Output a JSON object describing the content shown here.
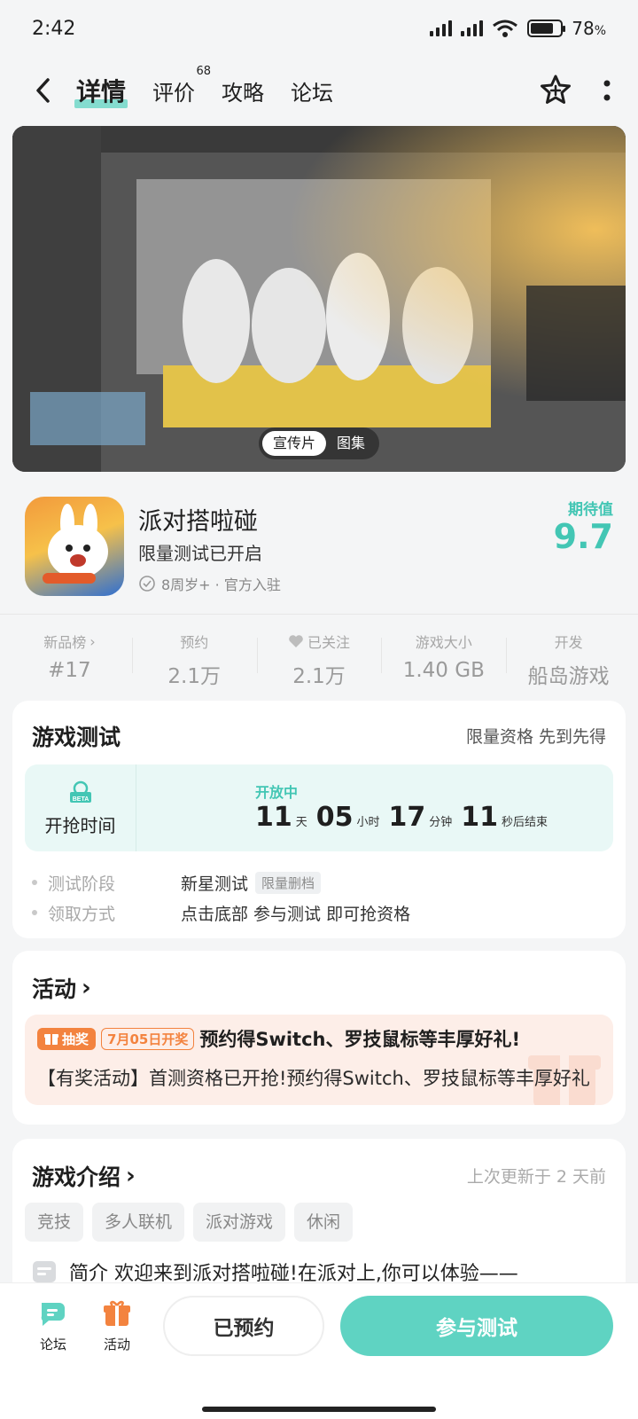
{
  "status": {
    "time": "2:42",
    "battery": "78",
    "battery_unit": "%"
  },
  "nav": {
    "tabs": [
      {
        "label": "详情"
      },
      {
        "label": "评价",
        "count": "68"
      },
      {
        "label": "攻略"
      },
      {
        "label": "论坛"
      }
    ]
  },
  "hero": {
    "toggle": [
      "宣传片",
      "图集"
    ]
  },
  "game": {
    "name": "派对搭啦碰",
    "subtitle": "限量测试已开启",
    "meta": "8周岁+ · 官方入驻",
    "expect_label": "期待值",
    "expect_value": "9.7"
  },
  "stats": [
    {
      "key": "新品榜",
      "value": "#17"
    },
    {
      "key": "预约",
      "value": "2.1万"
    },
    {
      "key": "已关注",
      "value": "2.1万"
    },
    {
      "key": "游戏大小",
      "value": "1.40 GB"
    },
    {
      "key": "开发",
      "value": "船岛游戏"
    }
  ],
  "test": {
    "title": "游戏测试",
    "note": "限量资格 先到先得",
    "box_label": "开抢时间",
    "status": "开放中",
    "countdown": {
      "d": "11",
      "d_unit": "天",
      "h": "05",
      "h_unit": "小时",
      "m": "17",
      "m_unit": "分钟",
      "s": "11",
      "s_unit": "秒后结束"
    },
    "rows": [
      {
        "key": "测试阶段",
        "value": "新星测试",
        "tag": "限量删档"
      },
      {
        "key": "领取方式",
        "value": "点击底部 参与测试 即可抢资格"
      }
    ]
  },
  "activity": {
    "title": "活动",
    "badge": "抽奖",
    "date_badge": "7月05日开奖",
    "headline": "预约得Switch、罗技鼠标等丰厚好礼!",
    "desc": "【有奖活动】首测资格已开抢!预约得Switch、罗技鼠标等丰厚好礼"
  },
  "intro": {
    "title": "游戏介绍",
    "updated": "上次更新于 2 天前",
    "tags": [
      "竞技",
      "多人联机",
      "派对游戏",
      "休闲"
    ],
    "text": "简介 欢迎来到派对搭啦碰!在派对上,你可以体验——"
  },
  "bottom": {
    "forum": "论坛",
    "activity": "活动",
    "reserved": "已预约",
    "join": "参与测试"
  },
  "colors": {
    "accent": "#5fd3c2",
    "accent_text": "#43c6b4",
    "orange": "#f3833f"
  }
}
